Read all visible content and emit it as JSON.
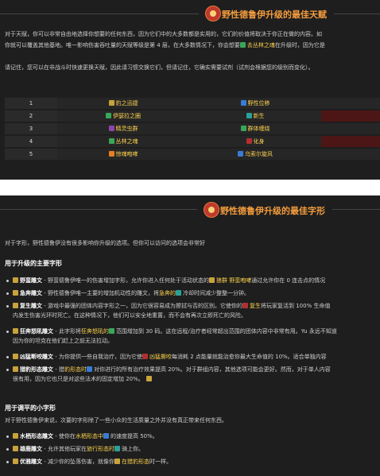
{
  "talents_section": {
    "title": "野性德鲁伊升级的最佳天赋",
    "para1_line1": "对于天赋，你可以非常自由地选择你想要的任何东西，因为它们中的大多数都是实用的，它们的价值将取决于你正在做的内容。如",
    "para1_line2_pre": "你就可以覆盖其他基地。唯一影响伤害吞吐量的天赋等级是第 4 层，在大多数情况下，你会想要",
    "para1_line2_link": "去丛林之魂",
    "para1_line2_post": "在升级时，因为它是",
    "para2": "请记住，您可以在非战斗时快速更换天赋，因此请习惯交换它们，但请记住，它确实需要试剂（试剂会根据您的级别而变化）。",
    "rows": [
      {
        "level": "1",
        "c1": "豹之迅捷",
        "c2": "野性位移",
        "c1_icon": "gold",
        "c2_icon": "blue",
        "c3_selected": false
      },
      {
        "level": "2",
        "c1": "伊瑟拉之圈",
        "c2": "新生",
        "c1_icon": "green",
        "c2_icon": "teal",
        "c3_selected": true
      },
      {
        "level": "3",
        "c1": "精灵虫群",
        "c2": "群体缠绕",
        "c1_icon": "purple",
        "c2_icon": "green",
        "c3_selected": false
      },
      {
        "level": "4",
        "c1": "丛林之魂",
        "c2": "化身",
        "c1_icon": "green",
        "c2_icon": "red",
        "c3_selected": true
      },
      {
        "level": "5",
        "c1": "惊魂咆哮",
        "c2": "乌索尔旋风",
        "c1_icon": "orange",
        "c2_icon": "blue",
        "c3_selected": false
      }
    ]
  },
  "glyphs_section": {
    "title": "野性德鲁伊升级的最佳字形",
    "intro": "对于字形，野性德鲁伊没有很多影响你升级的选项。但你可以访问的选项会非常好",
    "major_heading": "用于升级的主要字形",
    "major": [
      {
        "name": "野蛮雕文",
        "text_pre": " - 野蛮德鲁伊唯一的伤害增加字形，允许你进入任何处于活动状态的",
        "link": "狼群 野蛮咆哮",
        "text_post": "通过允许你在 0 连击点的情况",
        "line2": ""
      },
      {
        "name": "急奔雕文",
        "text_pre": " - 野性德鲁伊唯一主要的增加机动性的雕文，将",
        "link": "急奔的",
        "text_post": "冷却时间减少整整一分钟。",
        "line2": ""
      },
      {
        "name": "复生雕文",
        "text_pre": " - 游戏中最强的团体内容字形之一，因为它很容易成为擦拭与否的区别。它使你的",
        "link": "复生",
        "text_post": "将玩家复活到 100% 生命值",
        "line2": "内发生伤害光环时死亡。在这种情况下，他们可以安全地重置，而不会有再次立即死亡的风险。"
      },
      {
        "name": "狂奔怒吼雕文",
        "text_pre": " - 此字形将",
        "link": "狂奔怒吼的",
        "text_post": "范围增加到 30 码。这在远程/治疗者经常超出范围的团体内容中非常有用。Yu 永远不知道",
        "line2": "因为你的坦克在他们赶上之前无法拉动。"
      },
      {
        "name": "凶猛断咬雕文",
        "text_pre": " - 为你提供一些自我治疗，因为它使",
        "link": "凶猛撕咬",
        "text_post": "每消耗 2 点能量就能治愈你最大生命值的 10%。适合单独内容",
        "line2": ""
      },
      {
        "name": "猎豹形态雕文",
        "text_pre": " - 猎",
        "link": "豹形态时",
        "text_post": "对你进行的所有治疗效果提高 20%。对于群组内容，其他选项可能会更好。然而，对于单人内容",
        "line2": "很有用，因为它也只是对这些法术的固定增加 20%。"
      }
    ],
    "minor_heading": "用于调平的小字形",
    "minor_intro": "对于野性德鲁伊来说，次要的字形除了一些小众的生活质量之外并没有真正带来任何东西。",
    "minor": [
      {
        "name": "水栖形态雕文",
        "text_pre": " - 使你在",
        "link": "水栖形态中",
        "text_post": "的速度提高 50%。"
      },
      {
        "name": "雄鹿雕文",
        "text_pre": " - 允许其他玩家在",
        "link": "旅行形态时",
        "text_post": "骑上你。"
      },
      {
        "name": "优雅雕文",
        "text_pre": " - 减少你的坠落伤害，就像你",
        "link": "在猎豹形态",
        "text_post": "时一样。"
      }
    ]
  }
}
